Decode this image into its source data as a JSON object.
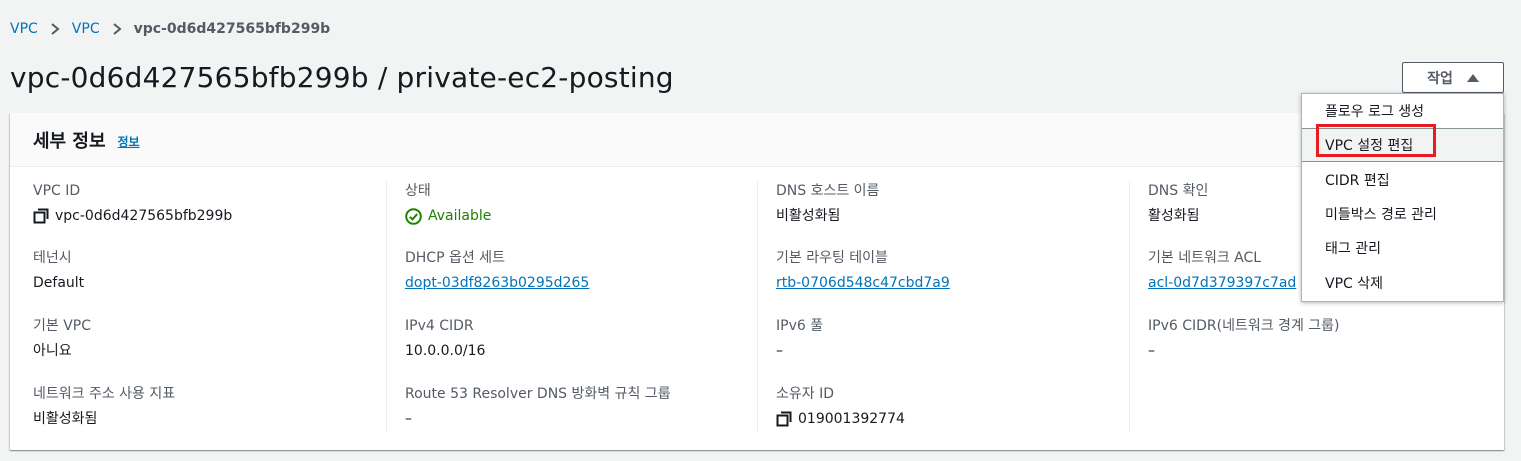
{
  "breadcrumb": {
    "items": [
      "VPC",
      "VPC"
    ],
    "current": "vpc-0d6d427565bfb299b"
  },
  "title": "vpc-0d6d427565bfb299b / private-ec2-posting",
  "actions": {
    "label": "작업"
  },
  "panel": {
    "heading": "세부 정보",
    "info_link": "정보"
  },
  "details": {
    "vpc_id": {
      "label": "VPC ID",
      "value": "vpc-0d6d427565bfb299b"
    },
    "tenancy": {
      "label": "테넌시",
      "value": "Default"
    },
    "default_vpc": {
      "label": "기본 VPC",
      "value": "아니요"
    },
    "network_address_usage": {
      "label": "네트워크 주소 사용 지표",
      "value": "비활성화됨"
    },
    "state": {
      "label": "상태",
      "value": "Available"
    },
    "dhcp": {
      "label": "DHCP 옵션 세트",
      "value": "dopt-03df8263b0295d265"
    },
    "ipv4_cidr": {
      "label": "IPv4 CIDR",
      "value": "10.0.0.0/16"
    },
    "route53": {
      "label": "Route 53 Resolver DNS 방화벽 규칙 그룹",
      "value": "–"
    },
    "dns_hostnames": {
      "label": "DNS 호스트 이름",
      "value": "비활성화됨"
    },
    "main_route_table": {
      "label": "기본 라우팅 테이블",
      "value": "rtb-0706d548c47cbd7a9"
    },
    "ipv6_pool": {
      "label": "IPv6 풀",
      "value": "–"
    },
    "owner_id": {
      "label": "소유자 ID",
      "value": "019001392774"
    },
    "dns_resolution": {
      "label": "DNS 확인",
      "value": "활성화됨"
    },
    "main_acl": {
      "label": "기본 네트워크 ACL",
      "value": "acl-0d7d379397c7ad"
    },
    "ipv6_cidr": {
      "label": "IPv6 CIDR(네트워크 경계 그룹)",
      "value": "–"
    }
  },
  "dropdown": {
    "items": [
      "플로우 로그 생성",
      "VPC 설정 편집",
      "CIDR 편집",
      "미들박스 경로 관리",
      "태그 관리",
      "VPC 삭제"
    ]
  },
  "colors": {
    "link": "#0073bb",
    "success": "#1d8102",
    "highlight": "#e51d23"
  }
}
